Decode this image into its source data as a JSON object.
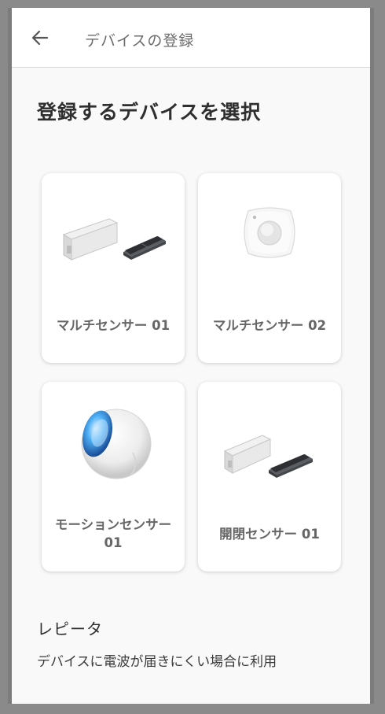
{
  "appbar": {
    "title": "デバイスの登録",
    "back_icon": "arrow-left-icon"
  },
  "heading": "登録するデバイスを選択",
  "devices": [
    {
      "label": "マルチセンサー 01",
      "icon": "multi-sensor-icon"
    },
    {
      "label": "マルチセンサー 02",
      "icon": "square-pir-sensor-icon"
    },
    {
      "label": "モーションセンサー 01",
      "icon": "motion-sensor-ball-icon"
    },
    {
      "label": "開閉センサー 01",
      "icon": "door-window-sensor-icon"
    }
  ],
  "section": {
    "title": "レピータ",
    "description": "デバイスに電波が届きにくい場合に利用"
  },
  "colors": {
    "background": "#f9f9f9",
    "card": "#ffffff",
    "frame": "#7c7c7c"
  }
}
